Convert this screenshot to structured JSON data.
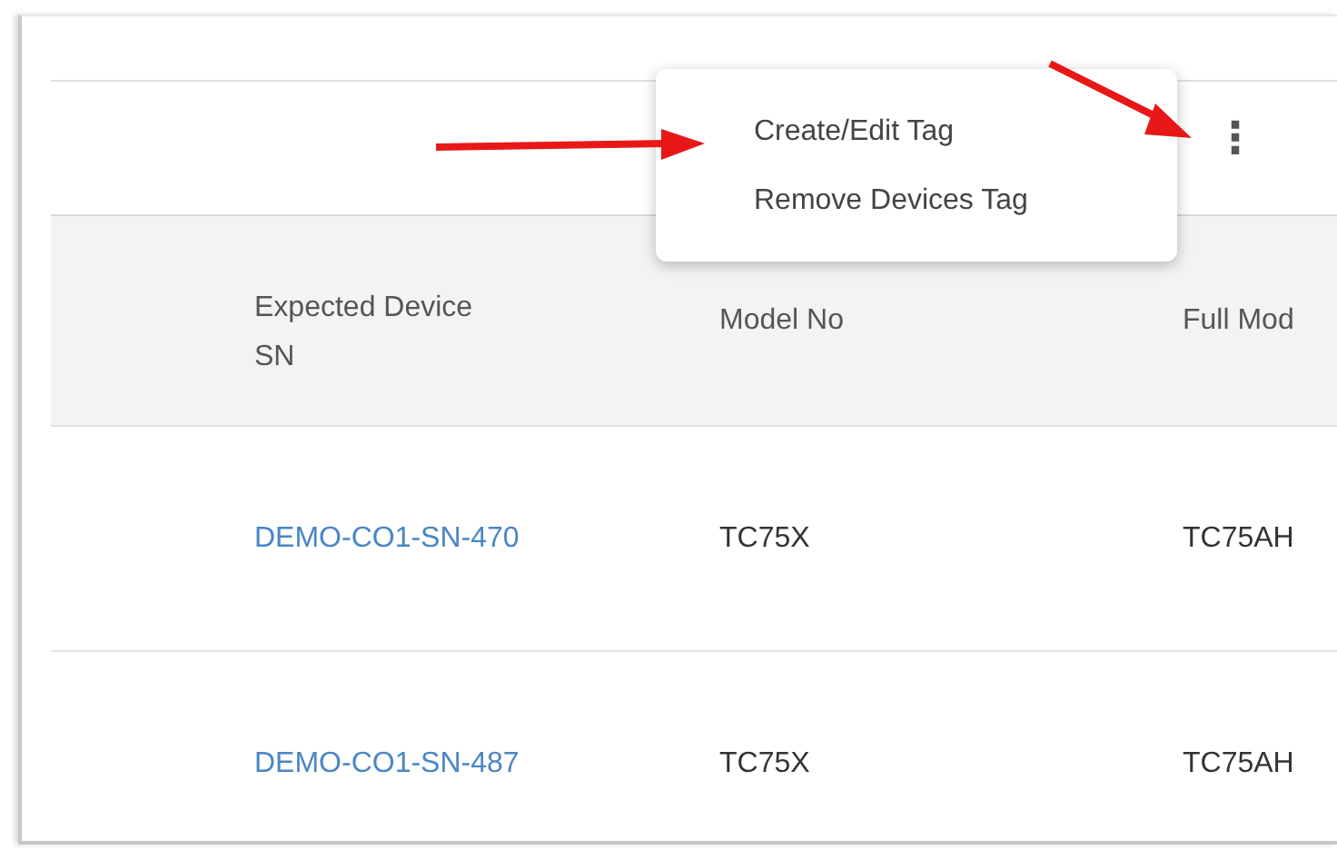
{
  "toolbar": {
    "more_button": "⋮"
  },
  "menu": {
    "items": [
      {
        "label": "Create/Edit Tag"
      },
      {
        "label": "Remove Devices Tag"
      }
    ]
  },
  "table": {
    "columns": [
      "Expected Device SN",
      "Model No",
      "Full Mod"
    ],
    "rows": [
      {
        "cells": [
          {
            "kind": "link",
            "text": "DEMO-CO1-SN-470"
          },
          {
            "kind": "text",
            "text": "TC75X"
          },
          {
            "kind": "text",
            "text": "TC75AH"
          }
        ]
      },
      {
        "cells": [
          {
            "kind": "link",
            "text": "DEMO-CO1-SN-487"
          },
          {
            "kind": "text",
            "text": "TC75X"
          },
          {
            "kind": "text",
            "text": "TC75AH"
          }
        ]
      }
    ]
  }
}
